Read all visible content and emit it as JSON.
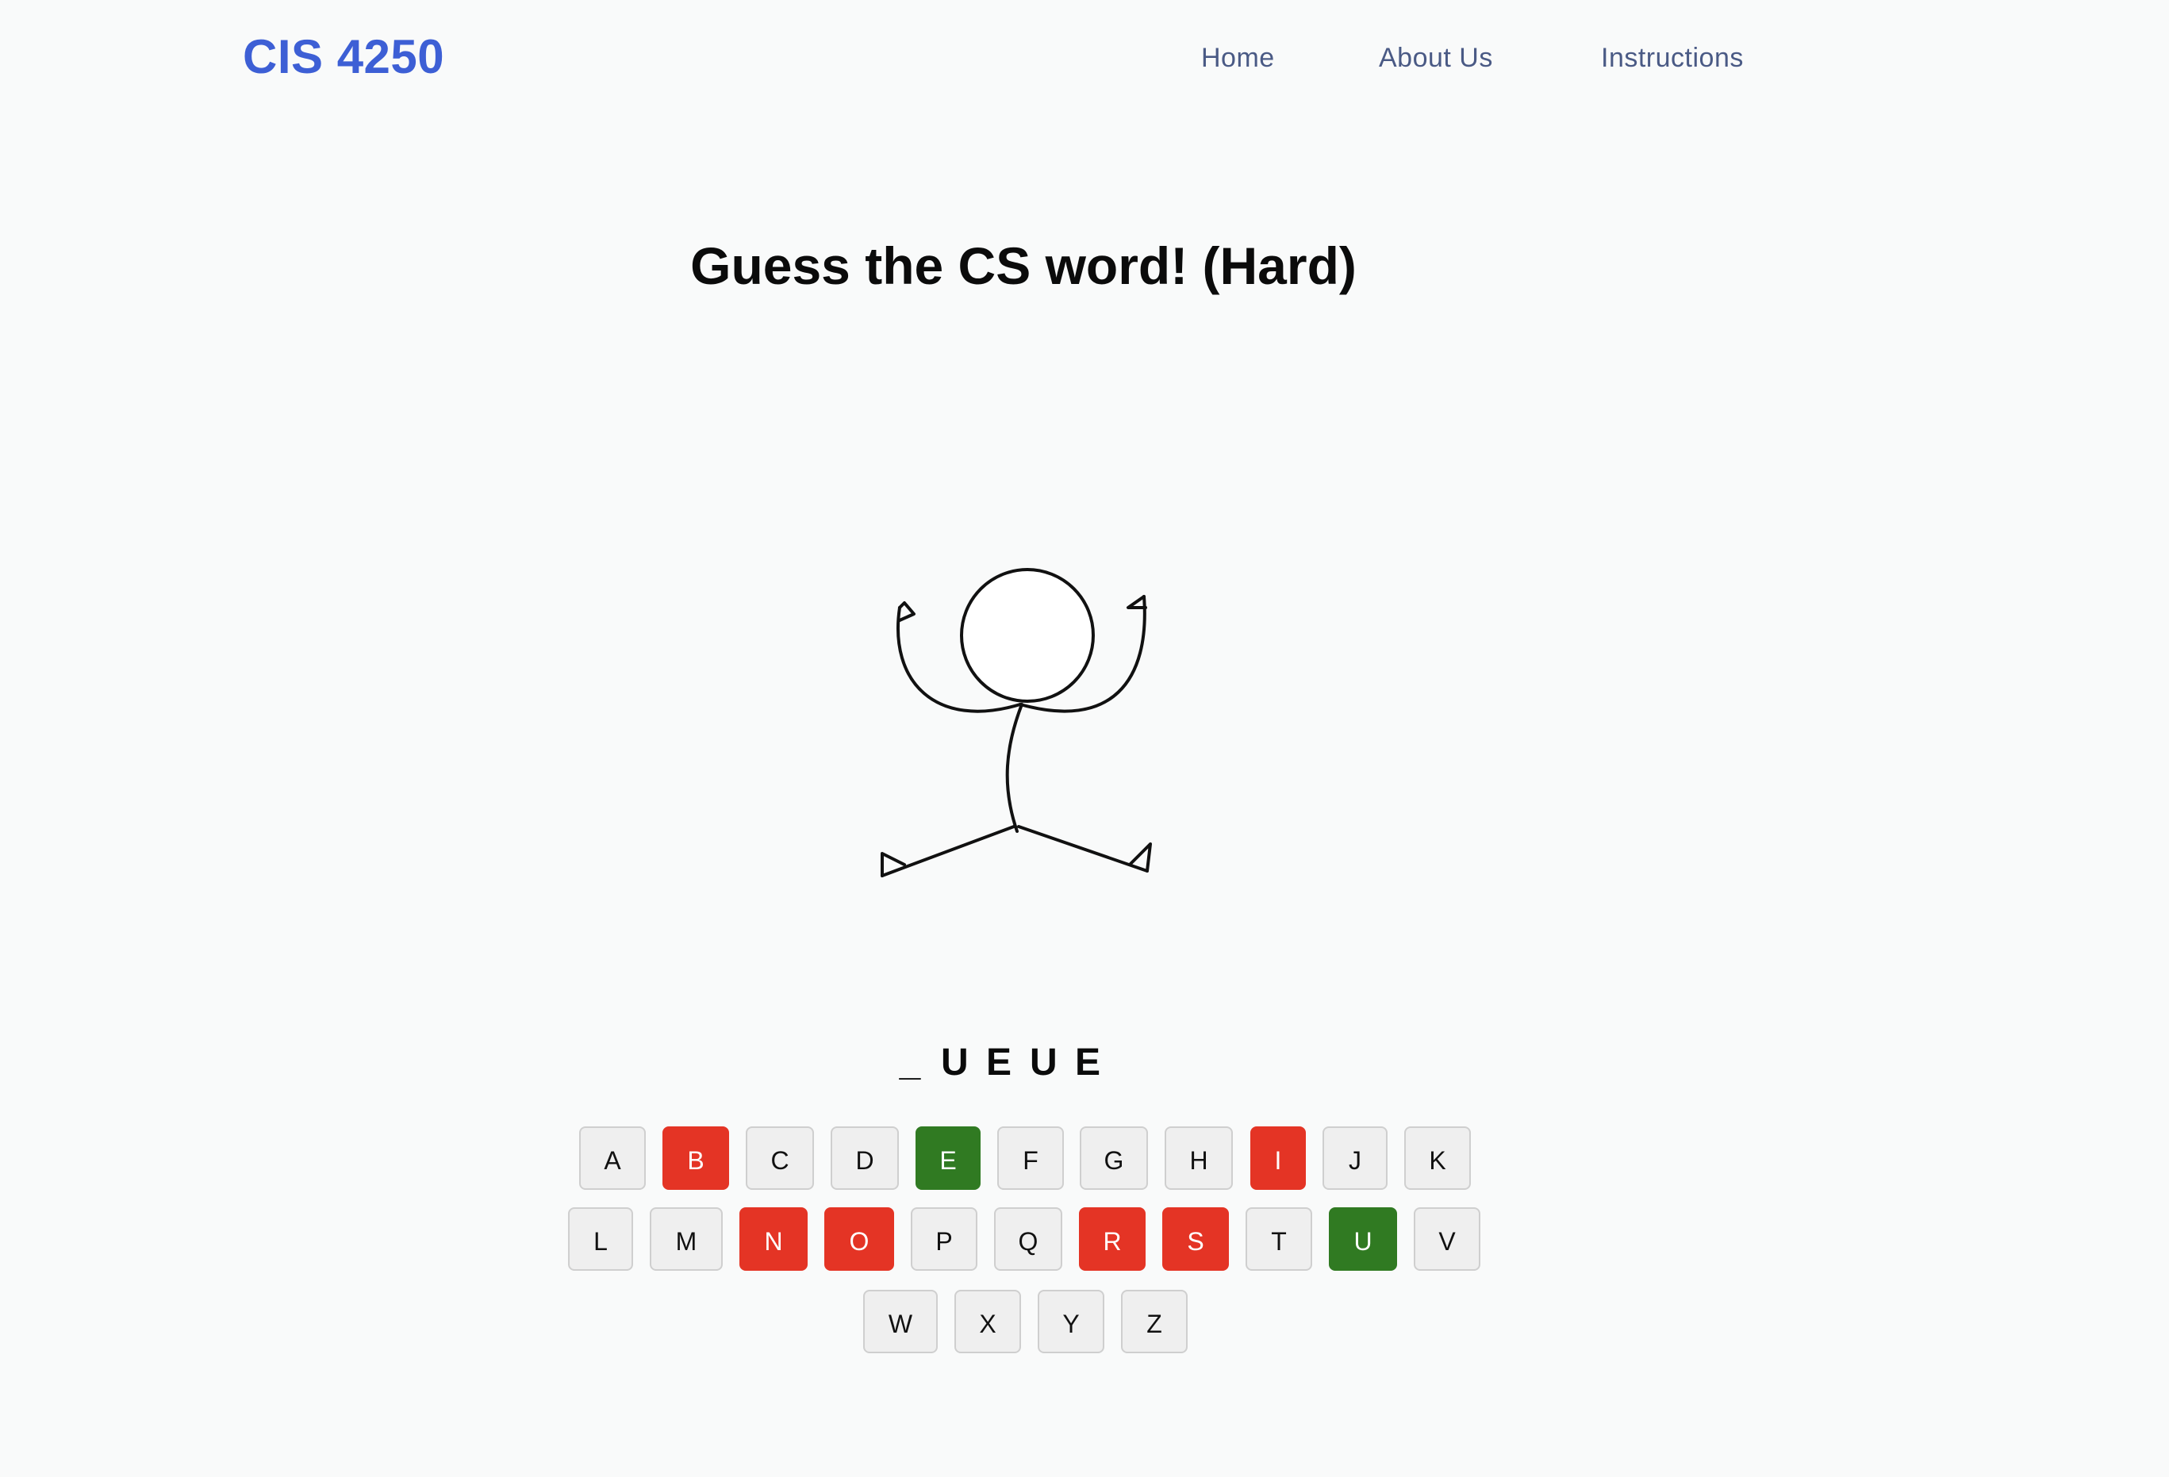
{
  "brand": "CIS 4250",
  "nav": {
    "home": "Home",
    "about": "About Us",
    "instructions": "Instructions"
  },
  "title": "Guess the CS word! (Hard)",
  "word": [
    "_",
    "U",
    "E",
    "U",
    "E"
  ],
  "colors": {
    "wrong": "#e43425",
    "correct": "#307a22",
    "default": "#efefef"
  },
  "keyboard": {
    "rows": [
      [
        {
          "letter": "A",
          "state": "unused"
        },
        {
          "letter": "B",
          "state": "wrong"
        },
        {
          "letter": "C",
          "state": "unused"
        },
        {
          "letter": "D",
          "state": "unused"
        },
        {
          "letter": "E",
          "state": "correct"
        },
        {
          "letter": "F",
          "state": "unused"
        },
        {
          "letter": "G",
          "state": "unused"
        },
        {
          "letter": "H",
          "state": "unused"
        },
        {
          "letter": "I",
          "state": "wrong"
        },
        {
          "letter": "J",
          "state": "unused"
        },
        {
          "letter": "K",
          "state": "unused"
        }
      ],
      [
        {
          "letter": "L",
          "state": "unused"
        },
        {
          "letter": "M",
          "state": "unused"
        },
        {
          "letter": "N",
          "state": "wrong"
        },
        {
          "letter": "O",
          "state": "wrong"
        },
        {
          "letter": "P",
          "state": "unused"
        },
        {
          "letter": "Q",
          "state": "unused"
        },
        {
          "letter": "R",
          "state": "wrong"
        },
        {
          "letter": "S",
          "state": "wrong"
        },
        {
          "letter": "T",
          "state": "unused"
        },
        {
          "letter": "U",
          "state": "correct"
        },
        {
          "letter": "V",
          "state": "unused"
        }
      ],
      [
        {
          "letter": "W",
          "state": "unused"
        },
        {
          "letter": "X",
          "state": "unused"
        },
        {
          "letter": "Y",
          "state": "unused"
        },
        {
          "letter": "Z",
          "state": "unused"
        }
      ]
    ]
  }
}
